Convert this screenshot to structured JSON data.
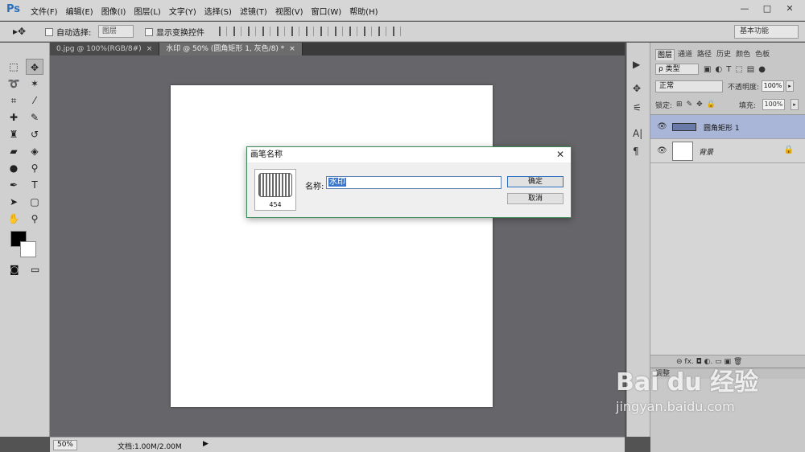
{
  "app": {
    "logo": "Ps"
  },
  "menu": [
    "文件(F)",
    "编辑(E)",
    "图像(I)",
    "图层(L)",
    "文字(Y)",
    "选择(S)",
    "滤镜(T)",
    "视图(V)",
    "窗口(W)",
    "帮助(H)"
  ],
  "window_controls": {
    "minimize": "—",
    "restore": "□",
    "close": "✕"
  },
  "options": {
    "auto_select_label": "自动选择:",
    "auto_select_value": "图层",
    "show_transform_label": "显示变换控件",
    "workspace": "基本功能"
  },
  "doc_tabs": [
    {
      "label": "0.jpg @ 100%(RGB/8#)",
      "close": "×"
    },
    {
      "label": "水印 @ 50% (圆角矩形 1, 灰色/8) *",
      "close": "×"
    }
  ],
  "status": {
    "zoom": "50%",
    "doc_size": "文档:1.00M/2.00M"
  },
  "layers_panel": {
    "tabs": [
      "图层",
      "通道",
      "路径",
      "历史",
      "颜色",
      "色板"
    ],
    "filter_type": "ρ 类型",
    "blend_mode": "正常",
    "opacity_label": "不透明度:",
    "opacity_value": "100%",
    "lock_label": "锁定:",
    "fill_label": "填充:",
    "fill_value": "100%",
    "layers": [
      {
        "name": "圆角矩形 1"
      },
      {
        "name": "背景"
      }
    ],
    "footer_icons": "⊖  fx.  ◘  ◐.  ▭  ▣  🗑",
    "adjust_tab": "调整"
  },
  "dialog": {
    "title": "画笔名称",
    "brush_size": "454",
    "name_label": "名称:",
    "name_value": "水印",
    "ok_label": "确定",
    "cancel_label": "取消"
  },
  "watermark": {
    "brand": "Bai du 经验",
    "url": "jingyan.baidu.com"
  }
}
